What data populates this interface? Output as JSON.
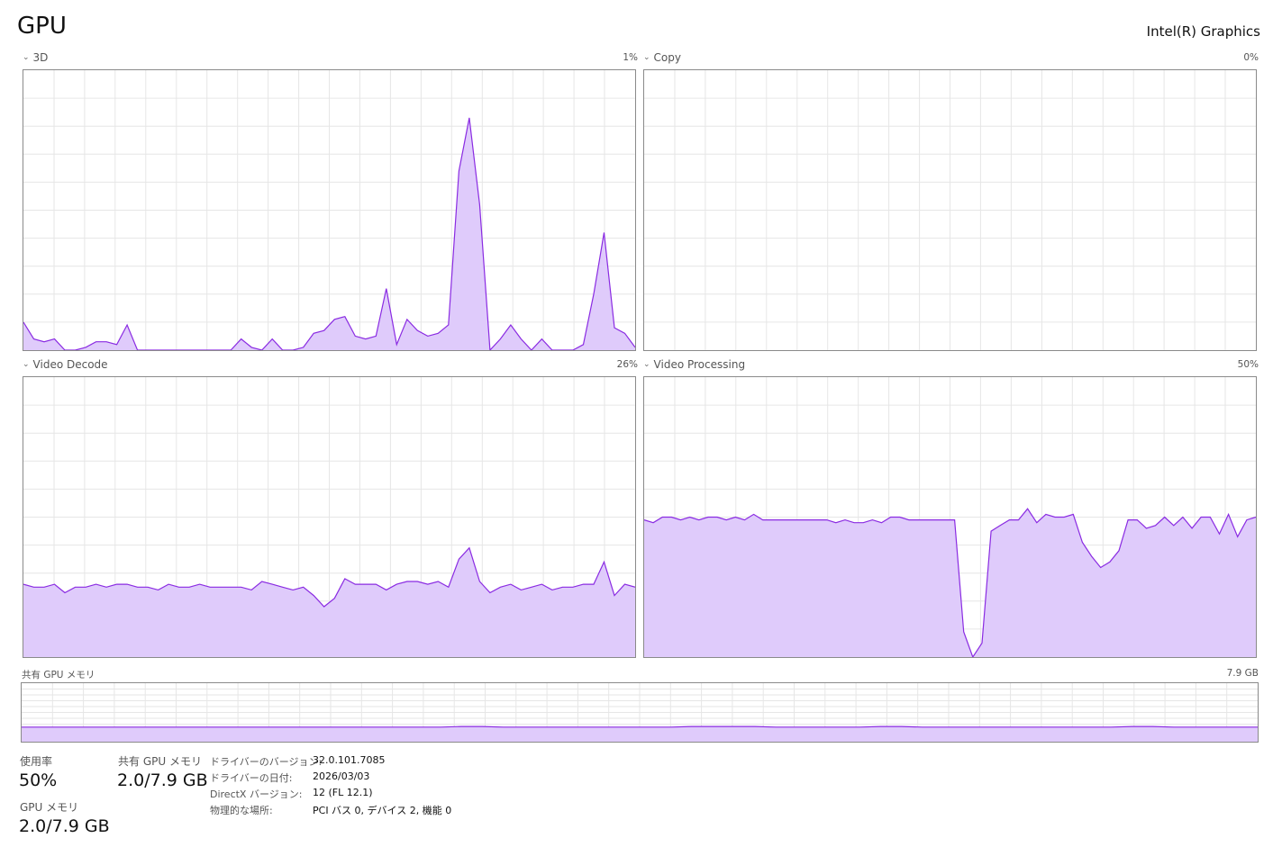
{
  "header": {
    "title": "GPU",
    "adapter": "Intel(R) Graphics"
  },
  "colors": {
    "line": "#8a2be2",
    "fill": "#dfcbfb",
    "grid": "#e6e6e6",
    "border": "#8a8a8a"
  },
  "graphs": [
    {
      "label": "3D",
      "max": "1%",
      "values": [
        10,
        4,
        3,
        4,
        0,
        0,
        1,
        3,
        3,
        2,
        9,
        0,
        0,
        0,
        0,
        0,
        0,
        0,
        0,
        0,
        0,
        4,
        1,
        0,
        4,
        0,
        0,
        1,
        6,
        7,
        11,
        12,
        5,
        4,
        5,
        22,
        2,
        11,
        7,
        5,
        6,
        9,
        64,
        83,
        52,
        0,
        4,
        9,
        4,
        0,
        4,
        0,
        0,
        0,
        2,
        20,
        42,
        8,
        6,
        1
      ]
    },
    {
      "label": "Copy",
      "max": "0%",
      "values": []
    },
    {
      "label": "Video Decode",
      "max": "26%",
      "values": [
        26,
        25,
        25,
        26,
        23,
        25,
        25,
        26,
        25,
        26,
        26,
        25,
        25,
        24,
        26,
        25,
        25,
        26,
        25,
        25,
        25,
        25,
        24,
        27,
        26,
        25,
        24,
        25,
        22,
        18,
        21,
        28,
        26,
        26,
        26,
        24,
        26,
        27,
        27,
        26,
        27,
        25,
        35,
        39,
        27,
        23,
        25,
        26,
        24,
        25,
        26,
        24,
        25,
        25,
        26,
        26,
        34,
        22,
        26,
        25
      ]
    },
    {
      "label": "Video Processing",
      "max": "50%",
      "values": [
        49,
        48,
        50,
        50,
        49,
        50,
        49,
        50,
        50,
        49,
        50,
        49,
        51,
        49,
        49,
        49,
        49,
        49,
        49,
        49,
        49,
        48,
        49,
        48,
        48,
        49,
        48,
        50,
        50,
        49,
        49,
        49,
        49,
        49,
        49,
        9,
        0,
        5,
        45,
        47,
        49,
        49,
        53,
        48,
        51,
        50,
        50,
        51,
        41,
        36,
        32,
        34,
        38,
        49,
        49,
        46,
        47,
        50,
        47,
        50,
        46,
        50,
        50,
        44,
        51,
        43,
        49,
        50
      ]
    }
  ],
  "shared_memory_graph": {
    "label": "共有 GPU メモリ",
    "max": "7.9 GB",
    "values": [
      25,
      25,
      25,
      25,
      25,
      25,
      25,
      25,
      25,
      25,
      25,
      25,
      25,
      25,
      25,
      25,
      25,
      25,
      25,
      25,
      25,
      26,
      26,
      25,
      25,
      25,
      25,
      25,
      25,
      25,
      25,
      25,
      26,
      26,
      26,
      26,
      25,
      25,
      25,
      25,
      25,
      26,
      26,
      25,
      25,
      25,
      25,
      25,
      25,
      25,
      25,
      25,
      25,
      26,
      26,
      25,
      25,
      25,
      25,
      25
    ]
  },
  "stats": {
    "utilization": {
      "label": "使用率",
      "value": "50%"
    },
    "shared_memory": {
      "label": "共有 GPU メモリ",
      "value": "2.0/7.9 GB"
    },
    "gpu_memory": {
      "label": "GPU メモリ",
      "value": "2.0/7.9 GB"
    }
  },
  "info": [
    {
      "key": "ドライバーのバージョン:",
      "value": "32.0.101.7085"
    },
    {
      "key": "ドライバーの日付:",
      "value": "2026/03/03"
    },
    {
      "key": "DirectX バージョン:",
      "value": "12 (FL 12.1)"
    },
    {
      "key": "物理的な場所:",
      "value": "PCI バス 0, デバイス 2, 機能 0"
    }
  ]
}
